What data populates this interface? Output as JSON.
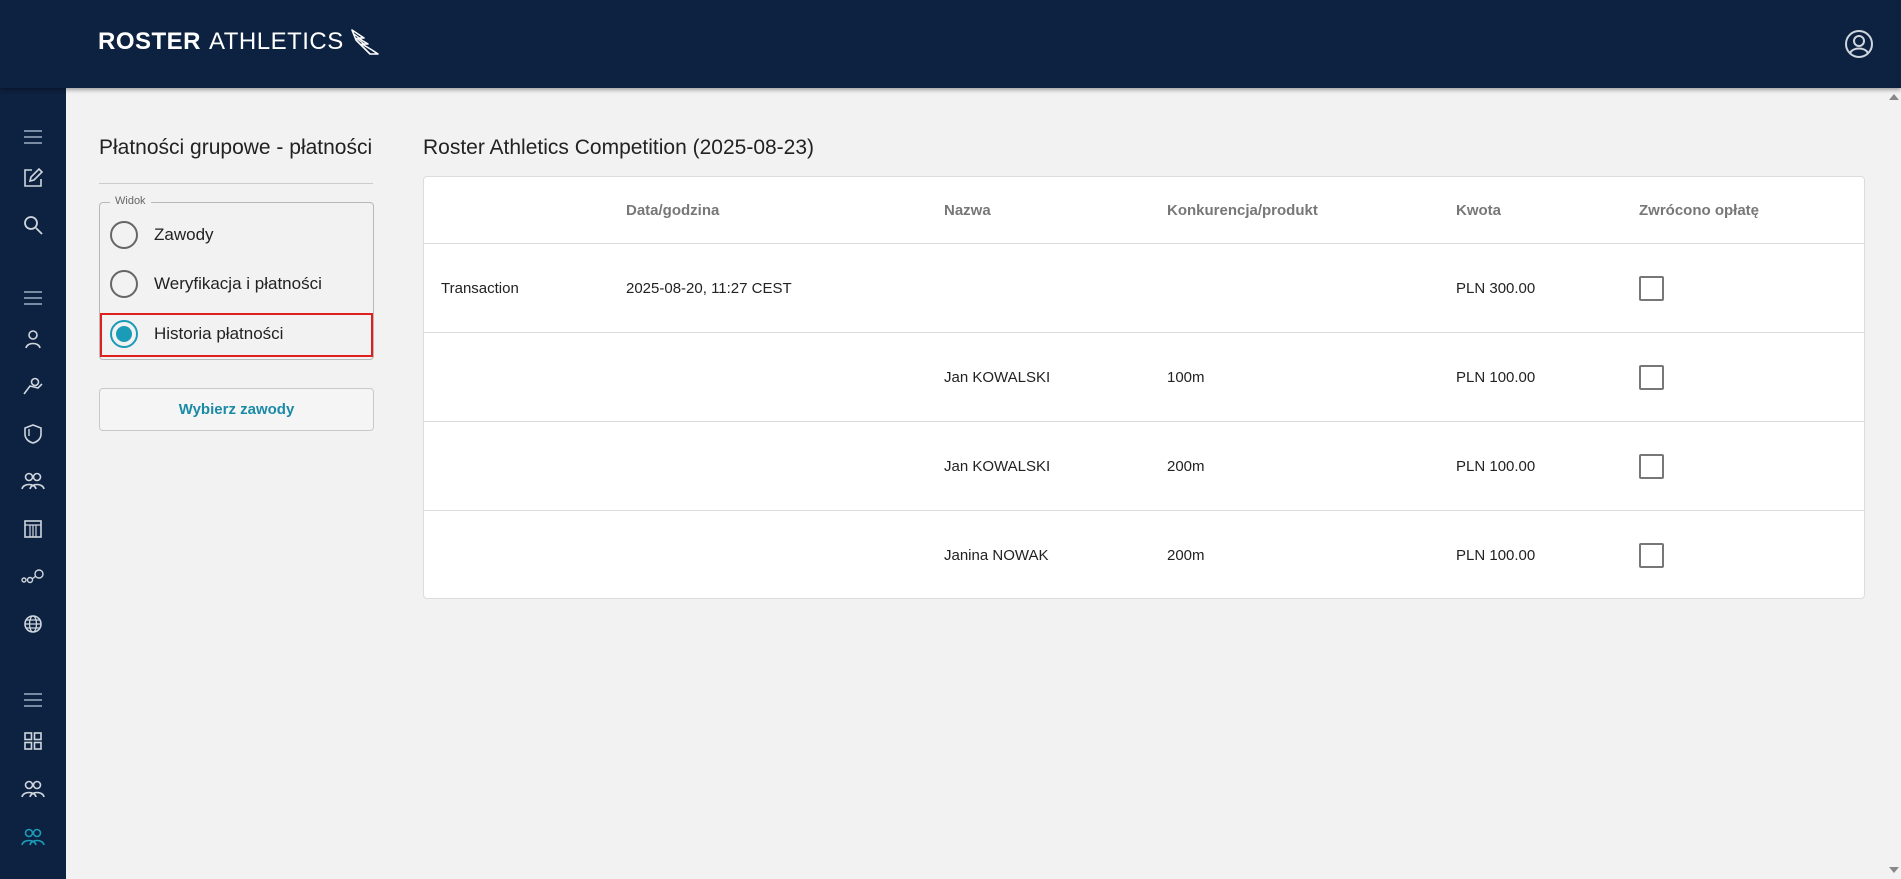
{
  "app": {
    "logo_bold": "ROSTER",
    "logo_light": "ATHLETICS"
  },
  "sidebar": {
    "icons": [
      "menu-icon",
      "edit-icon",
      "search-icon",
      "menu-icon",
      "person-icon",
      "runner-icon",
      "shield-icon",
      "people-icon",
      "calendar-grid-icon",
      "relay-icon",
      "globe-icon",
      "menu-icon",
      "dashboard-grid-icon",
      "people-icon",
      "people-icon"
    ],
    "active_index": 14
  },
  "left_panel": {
    "title": "Płatności grupowe - płatności",
    "legend": "Widok",
    "options": [
      {
        "label": "Zawody",
        "checked": false
      },
      {
        "label": "Weryfikacja i płatności",
        "checked": false
      },
      {
        "label": "Historia płatności",
        "checked": true
      }
    ],
    "select_button": "Wybierz zawody"
  },
  "main": {
    "title": "Roster Athletics Competition (2025-08-23)",
    "columns": [
      "",
      "Data/godzina",
      "Nazwa",
      "Konkurencja/produkt",
      "Kwota",
      "Zwrócono opłatę"
    ],
    "rows": [
      {
        "type": "Transaction",
        "datetime": "2025-08-20, 11:27 CEST",
        "name": "",
        "event": "",
        "amount": "PLN 300.00",
        "refunded": false
      },
      {
        "type": "",
        "datetime": "",
        "name": "Jan KOWALSKI",
        "event": "100m",
        "amount": "PLN 100.00",
        "refunded": false
      },
      {
        "type": "",
        "datetime": "",
        "name": "Jan KOWALSKI",
        "event": "200m",
        "amount": "PLN 100.00",
        "refunded": false
      },
      {
        "type": "",
        "datetime": "",
        "name": "Janina NOWAK",
        "event": "200m",
        "amount": "PLN 100.00",
        "refunded": false
      }
    ]
  },
  "colors": {
    "navbar": "#0d2240",
    "accent": "#1a9bb8",
    "highlight": "#e0201f"
  }
}
